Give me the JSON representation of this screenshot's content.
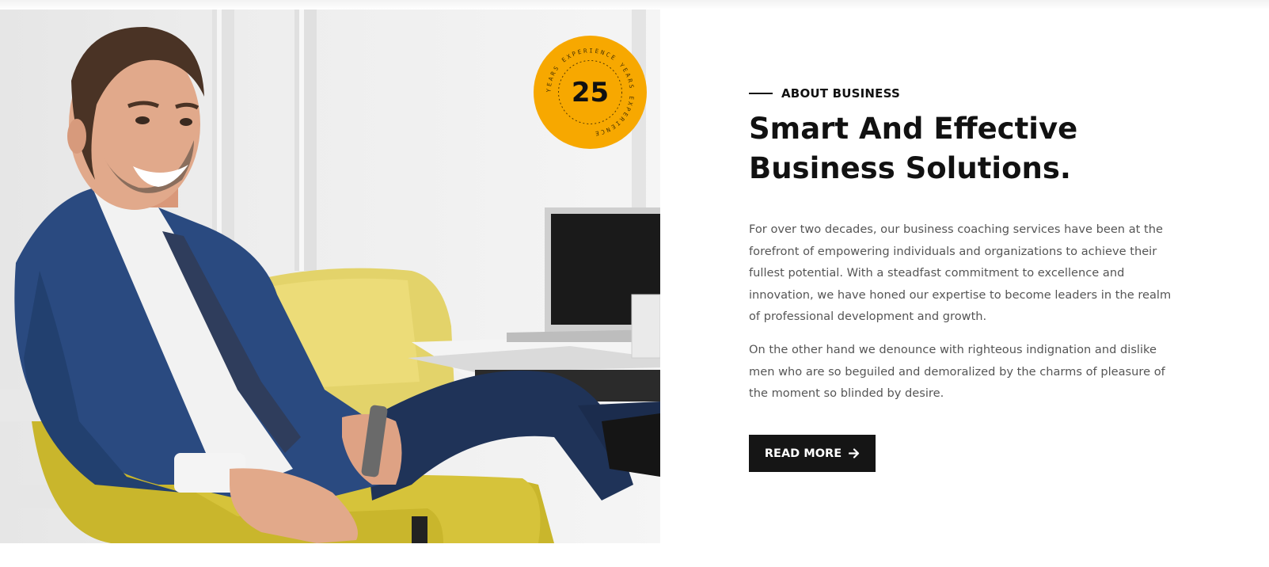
{
  "about": {
    "eyebrow": "ABOUT BUSINESS",
    "headline_line1": "Smart And Effective",
    "headline_line2": "Business Solutions.",
    "paragraph1": "For over two decades, our business coaching services have been at the forefront of empowering individuals and organizations to achieve their fullest potential. With a steadfast commitment to excellence and innovation, we have honed our expertise to become leaders in the realm of professional development and growth.",
    "paragraph2": "On the other hand we denounce with righteous indignation and dislike men who are so beguiled and demoralized by the charms of pleasure of the moment so blinded by desire.",
    "button_label": "READ MORE",
    "button_icon": "arrow-right-icon"
  },
  "badge": {
    "number": "25",
    "ring_text": "YEARS EXPERIENCE YEARS EXPERIENCE",
    "color": "#f7a800"
  },
  "photo": {
    "subject": "businessman-in-yellow-chair"
  },
  "colors": {
    "heading": "#111111",
    "body": "#555555",
    "button_bg": "#151515",
    "accent": "#f7a800"
  }
}
